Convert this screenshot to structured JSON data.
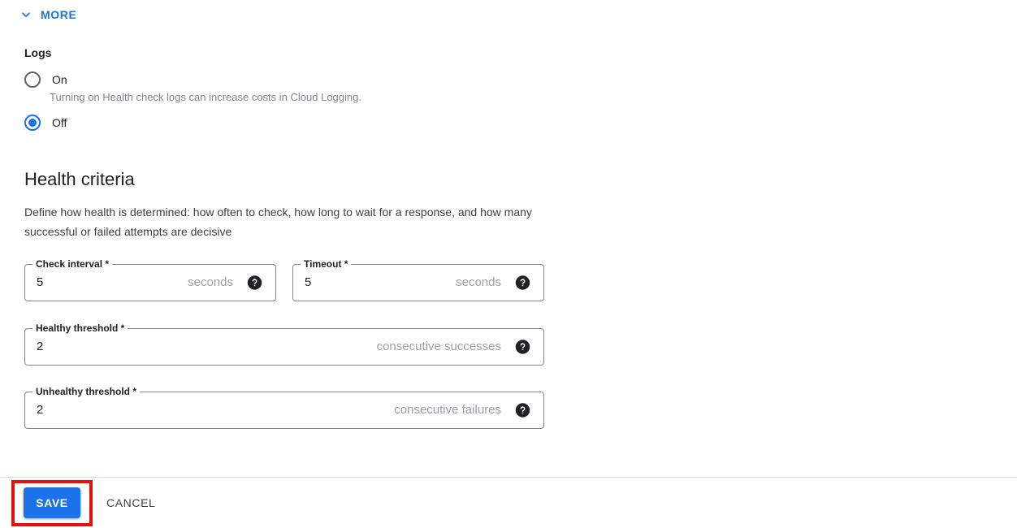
{
  "more_toggle": {
    "label": "MORE",
    "icon": "chevron-down-icon",
    "color": "#1a73e8",
    "expanded": true
  },
  "logs_section": {
    "heading": "Logs",
    "options": [
      {
        "label": "On",
        "selected": false,
        "helper": "Turning on Health check logs can increase costs in Cloud Logging."
      },
      {
        "label": "Off",
        "selected": true,
        "helper": ""
      }
    ]
  },
  "health_criteria": {
    "title": "Health criteria",
    "description": "Define how health is determined: how often to check, how long to wait for a response, and how many successful or failed attempts are decisive",
    "fields": [
      {
        "name": "check-interval",
        "label": "Check interval *",
        "value": "5",
        "suffix": "seconds",
        "help_icon": "help-circle-icon"
      },
      {
        "name": "timeout",
        "label": "Timeout *",
        "value": "5",
        "suffix": "seconds",
        "help_icon": "help-circle-icon"
      },
      {
        "name": "healthy-threshold",
        "label": "Healthy threshold *",
        "value": "2",
        "suffix": "consecutive successes",
        "help_icon": "help-circle-icon"
      },
      {
        "name": "unhealthy-threshold",
        "label": "Unhealthy threshold *",
        "value": "2",
        "suffix": "consecutive failures",
        "help_icon": "help-circle-icon"
      }
    ]
  },
  "footer": {
    "save_label": "SAVE",
    "cancel_label": "CANCEL",
    "save_color": "#1a73e8",
    "annotation_color": "#e8100f"
  }
}
